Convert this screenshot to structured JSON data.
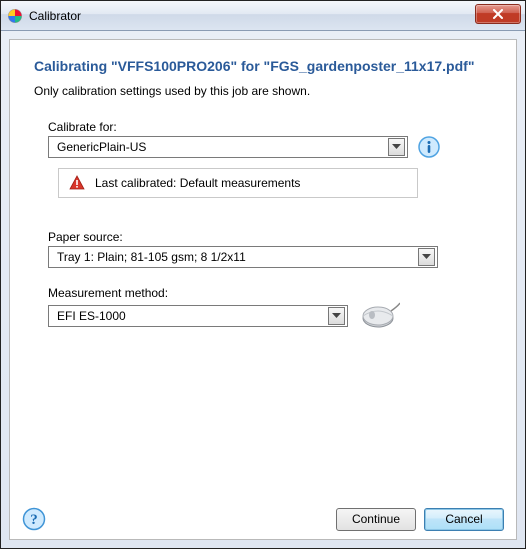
{
  "window": {
    "title": "Calibrator"
  },
  "heading": "Calibrating \"VFFS100PRO206\" for \"FGS_gardenposter_11x17.pdf\"",
  "subtext": "Only calibration settings used by this job are shown.",
  "calibrateFor": {
    "label": "Calibrate for:",
    "value": "GenericPlain-US"
  },
  "alert": {
    "text": "Last calibrated: Default measurements"
  },
  "paperSource": {
    "label": "Paper source:",
    "value": "Tray 1: Plain; 81-105 gsm; 8 1/2x11"
  },
  "measurementMethod": {
    "label": "Measurement method:",
    "value": "EFI ES-1000"
  },
  "buttons": {
    "continue": "Continue",
    "cancel": "Cancel"
  }
}
